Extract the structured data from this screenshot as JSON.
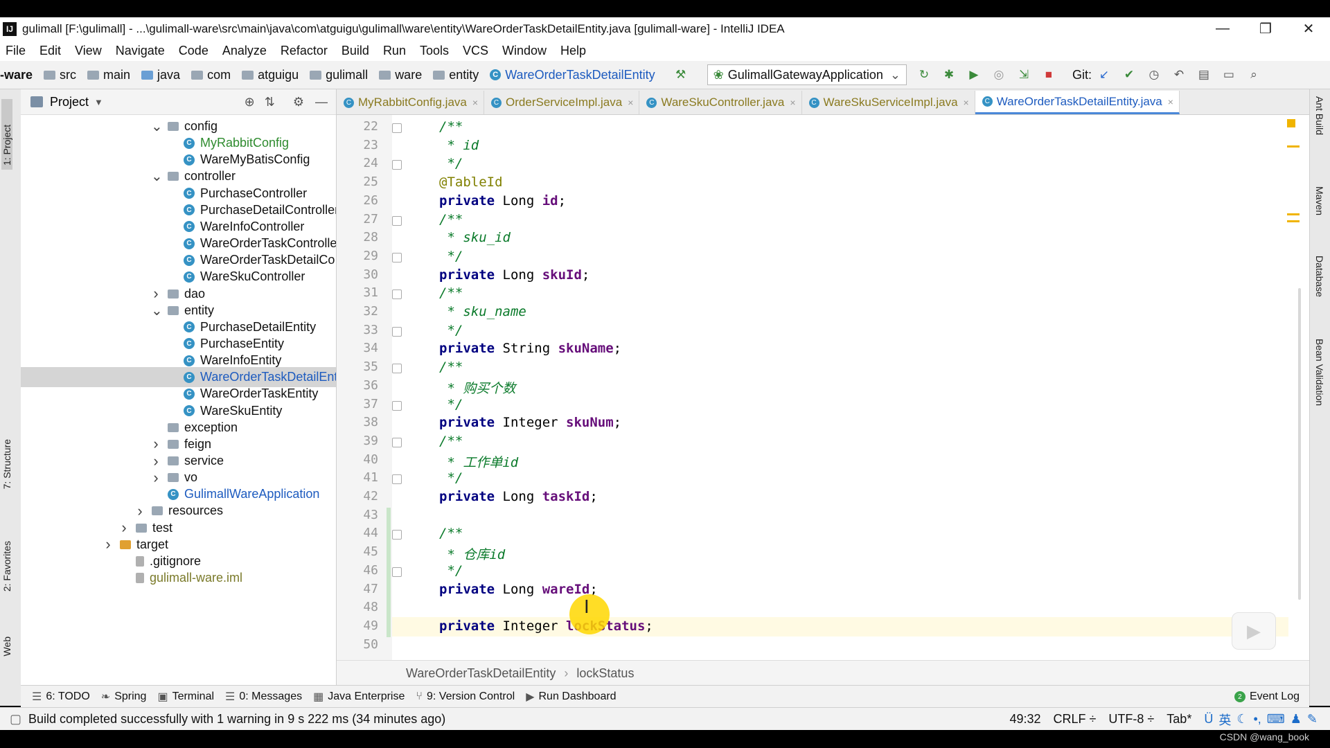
{
  "window": {
    "title": "gulimall [F:\\gulimall] - ...\\gulimall-ware\\src\\main\\java\\com\\atguigu\\gulimall\\ware\\entity\\WareOrderTaskDetailEntity.java [gulimall-ware] - IntelliJ IDEA",
    "minimize": "—",
    "restore": "❐",
    "close": "✕"
  },
  "menu": [
    "File",
    "Edit",
    "View",
    "Navigate",
    "Code",
    "Analyze",
    "Refactor",
    "Build",
    "Run",
    "Tools",
    "VCS",
    "Window",
    "Help"
  ],
  "nav": {
    "crumbs": [
      "-ware",
      "src",
      "main",
      "java",
      "com",
      "atguigu",
      "gulimall",
      "ware",
      "entity",
      "WareOrderTaskDetailEntity"
    ],
    "run_config": "GulimallGatewayApplication",
    "git_label": "Git:"
  },
  "project": {
    "header": "Project",
    "tree": [
      {
        "label": "config",
        "kind": "folder",
        "expanded": true,
        "indent": 1
      },
      {
        "label": "MyRabbitConfig",
        "kind": "class",
        "indent": 2,
        "style": "green"
      },
      {
        "label": "WareMyBatisConfig",
        "kind": "class",
        "indent": 2
      },
      {
        "label": "controller",
        "kind": "folder",
        "expanded": true,
        "indent": 1
      },
      {
        "label": "PurchaseController",
        "kind": "class",
        "indent": 2
      },
      {
        "label": "PurchaseDetailController",
        "kind": "class",
        "indent": 2
      },
      {
        "label": "WareInfoController",
        "kind": "class",
        "indent": 2
      },
      {
        "label": "WareOrderTaskControlle",
        "kind": "class",
        "indent": 2
      },
      {
        "label": "WareOrderTaskDetailCo",
        "kind": "class",
        "indent": 2
      },
      {
        "label": "WareSkuController",
        "kind": "class",
        "indent": 2
      },
      {
        "label": "dao",
        "kind": "folder",
        "expanded": false,
        "indent": 1
      },
      {
        "label": "entity",
        "kind": "folder",
        "expanded": true,
        "indent": 1
      },
      {
        "label": "PurchaseDetailEntity",
        "kind": "class",
        "indent": 2
      },
      {
        "label": "PurchaseEntity",
        "kind": "class",
        "indent": 2
      },
      {
        "label": "WareInfoEntity",
        "kind": "class",
        "indent": 2
      },
      {
        "label": "WareOrderTaskDetailEnt",
        "kind": "class",
        "indent": 2,
        "style": "blue",
        "selected": true
      },
      {
        "label": "WareOrderTaskEntity",
        "kind": "class",
        "indent": 2
      },
      {
        "label": "WareSkuEntity",
        "kind": "class",
        "indent": 2
      },
      {
        "label": "exception",
        "kind": "folder",
        "indent": 1
      },
      {
        "label": "feign",
        "kind": "folder",
        "expanded": false,
        "indent": 1
      },
      {
        "label": "service",
        "kind": "folder",
        "expanded": false,
        "indent": 1
      },
      {
        "label": "vo",
        "kind": "folder",
        "expanded": false,
        "indent": 1
      },
      {
        "label": "GulimallWareApplication",
        "kind": "class",
        "indent": 1,
        "style": "blue"
      },
      {
        "label": "resources",
        "kind": "folder",
        "expanded": false,
        "indent": 0
      },
      {
        "label": "test",
        "kind": "folder",
        "expanded": false,
        "indent": -1
      },
      {
        "label": "target",
        "kind": "folder",
        "expanded": false,
        "indent": -2,
        "color": "#e0a030"
      },
      {
        "label": ".gitignore",
        "kind": "file",
        "indent": -1
      },
      {
        "label": "gulimall-ware.iml",
        "kind": "file",
        "indent": -1,
        "style": "olive"
      }
    ]
  },
  "tabs": [
    {
      "label": "MyRabbitConfig.java",
      "active": false
    },
    {
      "label": "OrderServiceImpl.java",
      "active": false
    },
    {
      "label": "WareSkuController.java",
      "active": false
    },
    {
      "label": "WareSkuServiceImpl.java",
      "active": false
    },
    {
      "label": "WareOrderTaskDetailEntity.java",
      "active": true
    }
  ],
  "editor": {
    "lines": [
      {
        "n": "22",
        "segs": [
          [
            "doc",
            "/**"
          ]
        ]
      },
      {
        "n": "23",
        "segs": [
          [
            "doc",
            " * id"
          ]
        ]
      },
      {
        "n": "24",
        "segs": [
          [
            "doc",
            " */"
          ]
        ]
      },
      {
        "n": "25",
        "segs": [
          [
            "ann",
            "@TableId"
          ]
        ]
      },
      {
        "n": "26",
        "segs": [
          [
            "kw",
            "private "
          ],
          [
            "",
            "Long "
          ],
          [
            "fld",
            "id"
          ],
          [
            "",
            ";"
          ]
        ]
      },
      {
        "n": "27",
        "segs": [
          [
            "doc",
            "/**"
          ]
        ]
      },
      {
        "n": "28",
        "segs": [
          [
            "doc",
            " * sku_id"
          ]
        ]
      },
      {
        "n": "29",
        "segs": [
          [
            "doc",
            " */"
          ]
        ]
      },
      {
        "n": "30",
        "segs": [
          [
            "kw",
            "private "
          ],
          [
            "",
            "Long "
          ],
          [
            "fld",
            "skuId"
          ],
          [
            "",
            ";"
          ]
        ]
      },
      {
        "n": "31",
        "segs": [
          [
            "doc",
            "/**"
          ]
        ]
      },
      {
        "n": "32",
        "segs": [
          [
            "doc",
            " * sku_name"
          ]
        ]
      },
      {
        "n": "33",
        "segs": [
          [
            "doc",
            " */"
          ]
        ]
      },
      {
        "n": "34",
        "segs": [
          [
            "kw",
            "private "
          ],
          [
            "",
            "String "
          ],
          [
            "fld",
            "skuName"
          ],
          [
            "",
            ";"
          ]
        ]
      },
      {
        "n": "35",
        "segs": [
          [
            "doc",
            "/**"
          ]
        ]
      },
      {
        "n": "36",
        "segs": [
          [
            "doc",
            " * 购买个数"
          ]
        ]
      },
      {
        "n": "37",
        "segs": [
          [
            "doc",
            " */"
          ]
        ]
      },
      {
        "n": "38",
        "segs": [
          [
            "kw",
            "private "
          ],
          [
            "",
            "Integer "
          ],
          [
            "fld",
            "skuNum"
          ],
          [
            "",
            ";"
          ]
        ]
      },
      {
        "n": "39",
        "segs": [
          [
            "doc",
            "/**"
          ]
        ]
      },
      {
        "n": "40",
        "segs": [
          [
            "doc",
            " * 工作单id"
          ]
        ]
      },
      {
        "n": "41",
        "segs": [
          [
            "doc",
            " */"
          ]
        ]
      },
      {
        "n": "42",
        "segs": [
          [
            "kw",
            "private "
          ],
          [
            "",
            "Long "
          ],
          [
            "fld",
            "taskId"
          ],
          [
            "",
            ";"
          ]
        ]
      },
      {
        "n": "43",
        "segs": []
      },
      {
        "n": "44",
        "segs": [
          [
            "doc",
            "/**"
          ]
        ]
      },
      {
        "n": "45",
        "segs": [
          [
            "doc",
            " * 仓库id"
          ]
        ]
      },
      {
        "n": "46",
        "segs": [
          [
            "doc",
            " */"
          ]
        ]
      },
      {
        "n": "47",
        "segs": [
          [
            "kw",
            "private "
          ],
          [
            "",
            "Long "
          ],
          [
            "fld",
            "wareId"
          ],
          [
            "",
            ";"
          ]
        ]
      },
      {
        "n": "48",
        "segs": []
      },
      {
        "n": "49",
        "segs": [
          [
            "kw",
            "private "
          ],
          [
            "",
            "Integer "
          ],
          [
            "fld",
            "lockStatus"
          ],
          [
            "",
            ";"
          ]
        ]
      },
      {
        "n": "50",
        "segs": []
      }
    ],
    "breadcrumb": [
      "WareOrderTaskDetailEntity",
      "lockStatus"
    ]
  },
  "toolwindows": [
    {
      "icon": "☰",
      "label": "6: TODO"
    },
    {
      "icon": "❧",
      "label": "Spring"
    },
    {
      "icon": "▣",
      "label": "Terminal"
    },
    {
      "icon": "☰",
      "label": "0: Messages"
    },
    {
      "icon": "▦",
      "label": "Java Enterprise"
    },
    {
      "icon": "⑂",
      "label": "9: Version Control"
    },
    {
      "icon": "▶",
      "label": "Run Dashboard"
    }
  ],
  "event_log": "Event Log",
  "left_tabs": [
    "1: Project",
    "7: Structure",
    "2: Favorites",
    "Web"
  ],
  "right_tabs": [
    "Ant Build",
    "Maven",
    "Database",
    "Bean Validation"
  ],
  "status": {
    "message": "Build completed successfully with 1 warning in 9 s 222 ms (34 minutes ago)",
    "position": "49:32",
    "line_sep": "CRLF ÷",
    "encoding": "UTF-8 ÷",
    "indent": "Tab*",
    "ime": "英"
  },
  "watermark": "CSDN @wang_book"
}
